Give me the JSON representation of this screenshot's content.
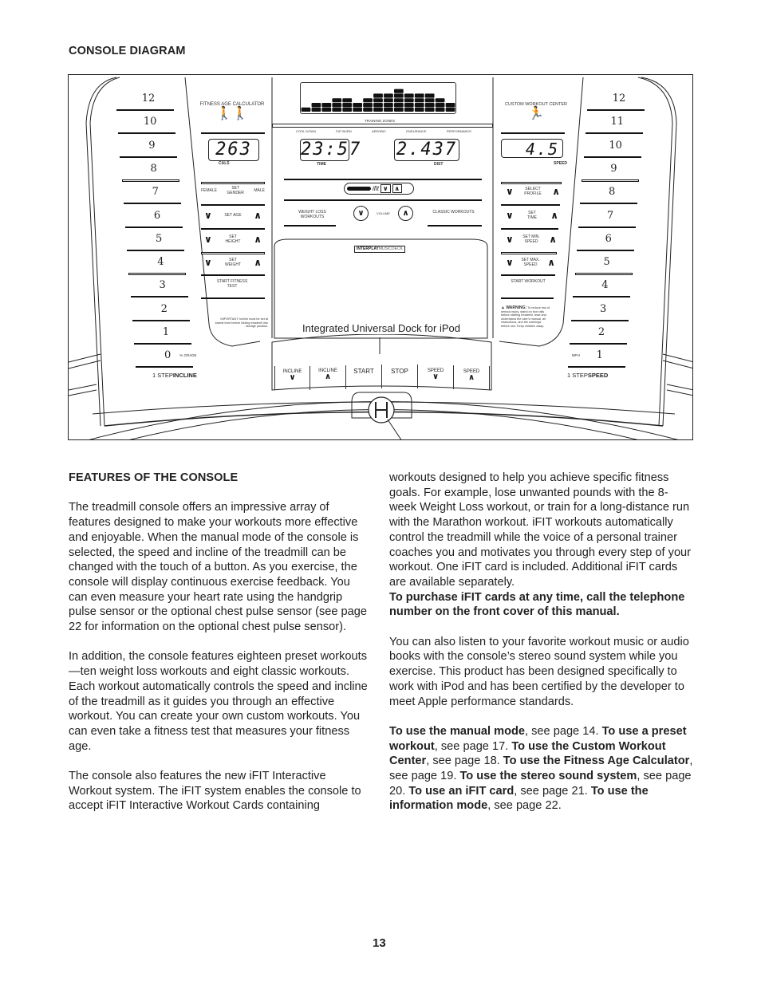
{
  "page": {
    "section_title": "CONSOLE DIAGRAM",
    "page_number": "13"
  },
  "diagram": {
    "callout": "Integrated Universal Dock for iPod",
    "incline_scale": {
      "values": [
        "12",
        "10",
        "9",
        "8",
        "7",
        "6",
        "5",
        "4",
        "3",
        "2",
        "1",
        "0"
      ],
      "unit": "% GRADE",
      "label_prefix": "1 STEP",
      "label_main": "INCLINE"
    },
    "speed_scale": {
      "values": [
        "12",
        "11",
        "10",
        "9",
        "8",
        "7",
        "6",
        "5",
        "4",
        "3",
        "2",
        "1"
      ],
      "unit": "MPH",
      "label_prefix": "1 STEP",
      "label_main": "SPEED"
    },
    "fitness_age": {
      "title": "FITNESS AGE CALCULATOR",
      "display_value": "263",
      "display_label": "CALS",
      "gender_female": "FEMALE",
      "gender_set": "SET GENDER",
      "gender_male": "MALE",
      "set_age": "SET AGE",
      "set_height": "SET HEIGHT",
      "set_weight": "SET WEIGHT",
      "start_test": "START FITNESS TEST",
      "important_note": "IMPORTANT: Incline must be set at lowest level before folding treadmill into storage position."
    },
    "center": {
      "profile_levels": [
        1,
        2,
        2,
        3,
        3,
        2,
        3,
        4,
        4,
        5,
        4,
        4,
        4,
        3,
        2
      ],
      "profile_max": 5,
      "training_zones_title": "TRAINING ZONES",
      "zones": [
        "COOL DOWN",
        "FAT BURN",
        "AEROBIC",
        "ENDURANCE",
        "PERFORMANCE"
      ],
      "time_value": "23:57",
      "time_label": "TIME",
      "dist_value": "2.437",
      "dist_label": "DIST",
      "ifit_label": "ifit",
      "weight_loss_label": "WEIGHT LOSS WORKOUTS",
      "volume_label": "VOLUME",
      "classic_label": "CLASSIC WORKOUTS",
      "dock_brand_bold": "INTERPLAY",
      "dock_brand_light": "MUSICDECK"
    },
    "bottom_buttons": [
      {
        "label": "INCLINE",
        "icon": "down"
      },
      {
        "label": "INCLINE",
        "icon": "up"
      },
      {
        "label": "START",
        "icon": ""
      },
      {
        "label": "STOP",
        "icon": ""
      },
      {
        "label": "SPEED",
        "icon": "down"
      },
      {
        "label": "SPEED",
        "icon": "up"
      }
    ],
    "custom_workout": {
      "title": "CUSTOM WORKOUT CENTER",
      "display_value": "4.5",
      "display_label": "SPEED",
      "select_profile": "SELECT PROFILE",
      "set_time": "SET TIME",
      "set_min_speed": "SET MIN. SPEED",
      "set_max_speed": "SET MAX. SPEED",
      "start_workout": "START WORKOUT",
      "warning_title": "WARNING:",
      "warning_text": "To reduce risk of serious injury, stand on foot rails before starting treadmill, read and understand the user's manual, all instructions, and the warnings before use. Keep children away."
    }
  },
  "features": {
    "title": "FEATURES OF THE CONSOLE",
    "p1": "The treadmill console offers an impressive array of features designed to make your workouts more effective and enjoyable. When the manual mode of the console is selected, the speed and incline of the treadmill can be changed with the touch of a button. As you exercise, the console will display continuous exercise feedback. You can even measure your heart rate using the handgrip pulse sensor or the optional chest pulse sensor (see page 22 for information on the optional chest pulse sensor).",
    "p2": "In addition, the console features eighteen preset workouts—ten weight loss workouts and eight classic workouts. Each workout automatically controls the speed and incline of the treadmill as it guides you through an effective workout. You can create your own custom workouts. You can even take a fitness test that measures your fitness age.",
    "p3": "The console also features the new iFIT Interactive Workout system. The iFIT system enables the console to accept iFIT Interactive Workout Cards containing",
    "p4": "workouts designed to help you achieve specific fitness goals. For example, lose unwanted pounds with the 8-week Weight Loss workout, or train for a long-distance run with the Marathon workout. iFIT workouts automatically control the treadmill while the voice of a personal trainer coaches you and motivates you through every step of your workout. One iFIT card is included. Additional iFIT cards are available separately.",
    "p4_bold": "To purchase iFIT cards at any time, call the telephone number on the front cover of this manual.",
    "p5": "You can also listen to your favorite workout music or audio books with the console’s stereo sound system while you exercise. This product has been designed specifically to work with iPod and has been certified by the developer to meet Apple performance standards.",
    "refs": [
      {
        "bold": "To use the manual mode",
        "text": ", see page 14. "
      },
      {
        "bold": "To use a preset workout",
        "text": ", see page 17. "
      },
      {
        "bold": "To use the Custom Workout Center",
        "text": ", see page 18. "
      },
      {
        "bold": "To use the Fitness Age Calculator",
        "text": ", see page 19. "
      },
      {
        "bold": "To use the stereo sound system",
        "text": ", see page 20. "
      },
      {
        "bold": "To use an iFIT card",
        "text": ", see page 21. "
      },
      {
        "bold": "To use the information mode",
        "text": ", see page 22."
      }
    ]
  }
}
